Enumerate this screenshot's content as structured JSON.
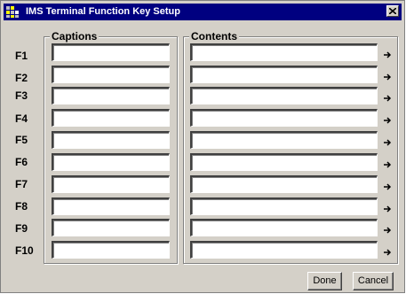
{
  "window": {
    "title": "IMS Terminal Function Key Setup",
    "close_label": "Close"
  },
  "groups": {
    "captions_label": "Captions",
    "contents_label": "Contents"
  },
  "rows": [
    {
      "key": "F1",
      "caption": "",
      "content": ""
    },
    {
      "key": "F2",
      "caption": "",
      "content": ""
    },
    {
      "key": "F3",
      "caption": "",
      "content": ""
    },
    {
      "key": "F4",
      "caption": "",
      "content": ""
    },
    {
      "key": "F5",
      "caption": "",
      "content": ""
    },
    {
      "key": "F6",
      "caption": "",
      "content": ""
    },
    {
      "key": "F7",
      "caption": "",
      "content": ""
    },
    {
      "key": "F8",
      "caption": "",
      "content": ""
    },
    {
      "key": "F9",
      "caption": "",
      "content": ""
    },
    {
      "key": "F10",
      "caption": "",
      "content": ""
    }
  ],
  "buttons": {
    "done": "Done",
    "cancel": "Cancel"
  },
  "icons": {
    "app": "ims-terminal-icon",
    "close": "close-icon",
    "row_arrow": "arrow-right-icon"
  },
  "colors": {
    "titlebar": "#000080",
    "face": "#d4d0c8"
  }
}
